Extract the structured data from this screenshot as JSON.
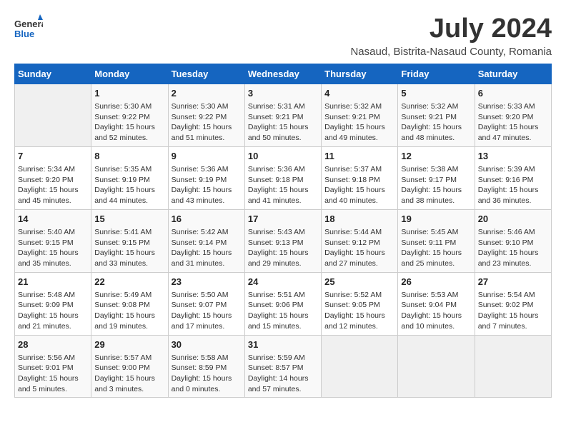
{
  "header": {
    "logo_general": "General",
    "logo_blue": "Blue",
    "month_year": "July 2024",
    "location": "Nasaud, Bistrita-Nasaud County, Romania"
  },
  "days_of_week": [
    "Sunday",
    "Monday",
    "Tuesday",
    "Wednesday",
    "Thursday",
    "Friday",
    "Saturday"
  ],
  "weeks": [
    [
      {
        "day": "",
        "content": ""
      },
      {
        "day": "1",
        "content": "Sunrise: 5:30 AM\nSunset: 9:22 PM\nDaylight: 15 hours\nand 52 minutes."
      },
      {
        "day": "2",
        "content": "Sunrise: 5:30 AM\nSunset: 9:22 PM\nDaylight: 15 hours\nand 51 minutes."
      },
      {
        "day": "3",
        "content": "Sunrise: 5:31 AM\nSunset: 9:21 PM\nDaylight: 15 hours\nand 50 minutes."
      },
      {
        "day": "4",
        "content": "Sunrise: 5:32 AM\nSunset: 9:21 PM\nDaylight: 15 hours\nand 49 minutes."
      },
      {
        "day": "5",
        "content": "Sunrise: 5:32 AM\nSunset: 9:21 PM\nDaylight: 15 hours\nand 48 minutes."
      },
      {
        "day": "6",
        "content": "Sunrise: 5:33 AM\nSunset: 9:20 PM\nDaylight: 15 hours\nand 47 minutes."
      }
    ],
    [
      {
        "day": "7",
        "content": "Sunrise: 5:34 AM\nSunset: 9:20 PM\nDaylight: 15 hours\nand 45 minutes."
      },
      {
        "day": "8",
        "content": "Sunrise: 5:35 AM\nSunset: 9:19 PM\nDaylight: 15 hours\nand 44 minutes."
      },
      {
        "day": "9",
        "content": "Sunrise: 5:36 AM\nSunset: 9:19 PM\nDaylight: 15 hours\nand 43 minutes."
      },
      {
        "day": "10",
        "content": "Sunrise: 5:36 AM\nSunset: 9:18 PM\nDaylight: 15 hours\nand 41 minutes."
      },
      {
        "day": "11",
        "content": "Sunrise: 5:37 AM\nSunset: 9:18 PM\nDaylight: 15 hours\nand 40 minutes."
      },
      {
        "day": "12",
        "content": "Sunrise: 5:38 AM\nSunset: 9:17 PM\nDaylight: 15 hours\nand 38 minutes."
      },
      {
        "day": "13",
        "content": "Sunrise: 5:39 AM\nSunset: 9:16 PM\nDaylight: 15 hours\nand 36 minutes."
      }
    ],
    [
      {
        "day": "14",
        "content": "Sunrise: 5:40 AM\nSunset: 9:15 PM\nDaylight: 15 hours\nand 35 minutes."
      },
      {
        "day": "15",
        "content": "Sunrise: 5:41 AM\nSunset: 9:15 PM\nDaylight: 15 hours\nand 33 minutes."
      },
      {
        "day": "16",
        "content": "Sunrise: 5:42 AM\nSunset: 9:14 PM\nDaylight: 15 hours\nand 31 minutes."
      },
      {
        "day": "17",
        "content": "Sunrise: 5:43 AM\nSunset: 9:13 PM\nDaylight: 15 hours\nand 29 minutes."
      },
      {
        "day": "18",
        "content": "Sunrise: 5:44 AM\nSunset: 9:12 PM\nDaylight: 15 hours\nand 27 minutes."
      },
      {
        "day": "19",
        "content": "Sunrise: 5:45 AM\nSunset: 9:11 PM\nDaylight: 15 hours\nand 25 minutes."
      },
      {
        "day": "20",
        "content": "Sunrise: 5:46 AM\nSunset: 9:10 PM\nDaylight: 15 hours\nand 23 minutes."
      }
    ],
    [
      {
        "day": "21",
        "content": "Sunrise: 5:48 AM\nSunset: 9:09 PM\nDaylight: 15 hours\nand 21 minutes."
      },
      {
        "day": "22",
        "content": "Sunrise: 5:49 AM\nSunset: 9:08 PM\nDaylight: 15 hours\nand 19 minutes."
      },
      {
        "day": "23",
        "content": "Sunrise: 5:50 AM\nSunset: 9:07 PM\nDaylight: 15 hours\nand 17 minutes."
      },
      {
        "day": "24",
        "content": "Sunrise: 5:51 AM\nSunset: 9:06 PM\nDaylight: 15 hours\nand 15 minutes."
      },
      {
        "day": "25",
        "content": "Sunrise: 5:52 AM\nSunset: 9:05 PM\nDaylight: 15 hours\nand 12 minutes."
      },
      {
        "day": "26",
        "content": "Sunrise: 5:53 AM\nSunset: 9:04 PM\nDaylight: 15 hours\nand 10 minutes."
      },
      {
        "day": "27",
        "content": "Sunrise: 5:54 AM\nSunset: 9:02 PM\nDaylight: 15 hours\nand 7 minutes."
      }
    ],
    [
      {
        "day": "28",
        "content": "Sunrise: 5:56 AM\nSunset: 9:01 PM\nDaylight: 15 hours\nand 5 minutes."
      },
      {
        "day": "29",
        "content": "Sunrise: 5:57 AM\nSunset: 9:00 PM\nDaylight: 15 hours\nand 3 minutes."
      },
      {
        "day": "30",
        "content": "Sunrise: 5:58 AM\nSunset: 8:59 PM\nDaylight: 15 hours\nand 0 minutes."
      },
      {
        "day": "31",
        "content": "Sunrise: 5:59 AM\nSunset: 8:57 PM\nDaylight: 14 hours\nand 57 minutes."
      },
      {
        "day": "",
        "content": ""
      },
      {
        "day": "",
        "content": ""
      },
      {
        "day": "",
        "content": ""
      }
    ]
  ]
}
